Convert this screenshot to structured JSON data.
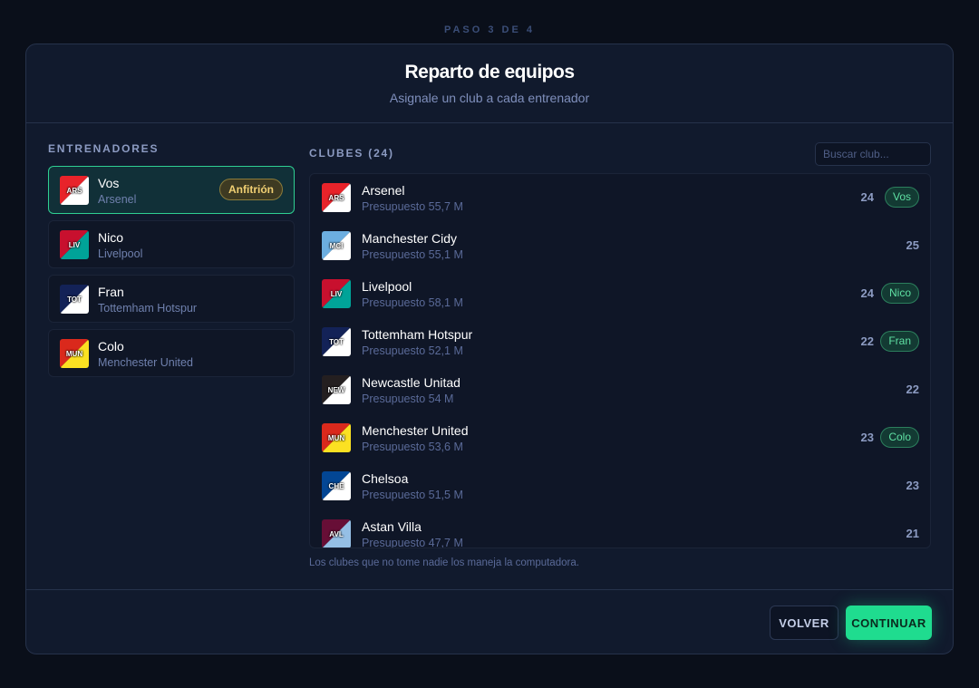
{
  "step_label": "PASO 3 DE 4",
  "header": {
    "title": "Reparto de equipos",
    "subtitle": "Asignale un club a cada entrenador"
  },
  "coaches": {
    "title": "ENTRENADORES",
    "items": [
      {
        "name": "Vos",
        "club": "Arsenel",
        "abbr": "ARS",
        "colors": [
          "#e8232a",
          "#ffffff"
        ],
        "badge": "Anfitrión",
        "active": true
      },
      {
        "name": "Nico",
        "club": "Livelpool",
        "abbr": "LIV",
        "colors": [
          "#c8102e",
          "#00a398"
        ],
        "badge": "",
        "active": false
      },
      {
        "name": "Fran",
        "club": "Tottemham Hotspur",
        "abbr": "TOT",
        "colors": [
          "#132257",
          "#ffffff"
        ],
        "badge": "",
        "active": false
      },
      {
        "name": "Colo",
        "club": "Menchester United",
        "abbr": "MUN",
        "colors": [
          "#da291c",
          "#fbe122"
        ],
        "badge": "",
        "active": false
      }
    ]
  },
  "clubs": {
    "title": "CLUBES (24)",
    "search_placeholder": "Buscar club...",
    "items": [
      {
        "name": "Arsenel",
        "budget": "Presupuesto 55,7 M",
        "rating": "24",
        "owner": "Vos",
        "abbr": "ARS",
        "colors": [
          "#e8232a",
          "#ffffff"
        ]
      },
      {
        "name": "Manchester Cidy",
        "budget": "Presupuesto 55,1 M",
        "rating": "25",
        "owner": "",
        "abbr": "MCI",
        "colors": [
          "#6caee0",
          "#ffffff"
        ]
      },
      {
        "name": "Livelpool",
        "budget": "Presupuesto 58,1 M",
        "rating": "24",
        "owner": "Nico",
        "abbr": "LIV",
        "colors": [
          "#c8102e",
          "#00a398"
        ]
      },
      {
        "name": "Tottemham Hotspur",
        "budget": "Presupuesto 52,1 M",
        "rating": "22",
        "owner": "Fran",
        "abbr": "TOT",
        "colors": [
          "#132257",
          "#ffffff"
        ]
      },
      {
        "name": "Newcastle Unitad",
        "budget": "Presupuesto 54 M",
        "rating": "22",
        "owner": "",
        "abbr": "NEW",
        "colors": [
          "#241f20",
          "#ffffff"
        ]
      },
      {
        "name": "Menchester United",
        "budget": "Presupuesto 53,6 M",
        "rating": "23",
        "owner": "Colo",
        "abbr": "MUN",
        "colors": [
          "#da291c",
          "#fbe122"
        ]
      },
      {
        "name": "Chelsoa",
        "budget": "Presupuesto 51,5 M",
        "rating": "23",
        "owner": "",
        "abbr": "CHE",
        "colors": [
          "#034694",
          "#ffffff"
        ]
      },
      {
        "name": "Astan Villa",
        "budget": "Presupuesto 47,7 M",
        "rating": "21",
        "owner": "",
        "abbr": "AVL",
        "colors": [
          "#670e36",
          "#95bfe5"
        ]
      }
    ],
    "footnote": "Los clubes que no tome nadie los maneja la computadora."
  },
  "footer": {
    "back_label": "VOLVER",
    "next_label": "CONTINUAR"
  }
}
